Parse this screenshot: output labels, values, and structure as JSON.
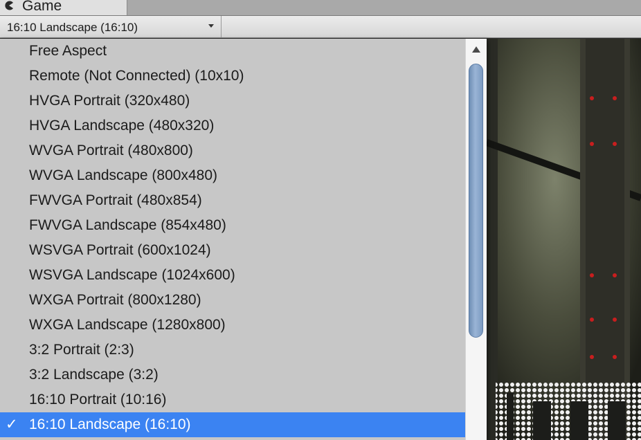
{
  "window": {
    "tab_title": "Game",
    "tab_icon": "pacman-icon"
  },
  "toolbar": {
    "aspect_selected": "16:10 Landscape (16:10)",
    "dropdown_icon": "chevron-down-icon"
  },
  "menu": {
    "check_mark": "✓",
    "items": [
      {
        "label": "Free Aspect"
      },
      {
        "label": "Remote (Not Connected) (10x10)"
      },
      {
        "label": "HVGA Portrait (320x480)"
      },
      {
        "label": "HVGA Landscape (480x320)"
      },
      {
        "label": "WVGA Portrait (480x800)"
      },
      {
        "label": "WVGA Landscape (800x480)"
      },
      {
        "label": "FWVGA Portrait (480x854)"
      },
      {
        "label": "FWVGA Landscape (854x480)"
      },
      {
        "label": "WSVGA Portrait (600x1024)"
      },
      {
        "label": "WSVGA Landscape (1024x600)"
      },
      {
        "label": "WXGA Portrait (800x1280)"
      },
      {
        "label": "WXGA Landscape (1280x800)"
      },
      {
        "label": "3:2 Portrait (2:3)"
      },
      {
        "label": "3:2 Landscape (3:2)"
      },
      {
        "label": "16:10 Portrait (10:16)"
      },
      {
        "label": "16:10 Landscape (16:10)"
      }
    ],
    "selected_index": 15,
    "selection_color": "#3b83f2"
  }
}
